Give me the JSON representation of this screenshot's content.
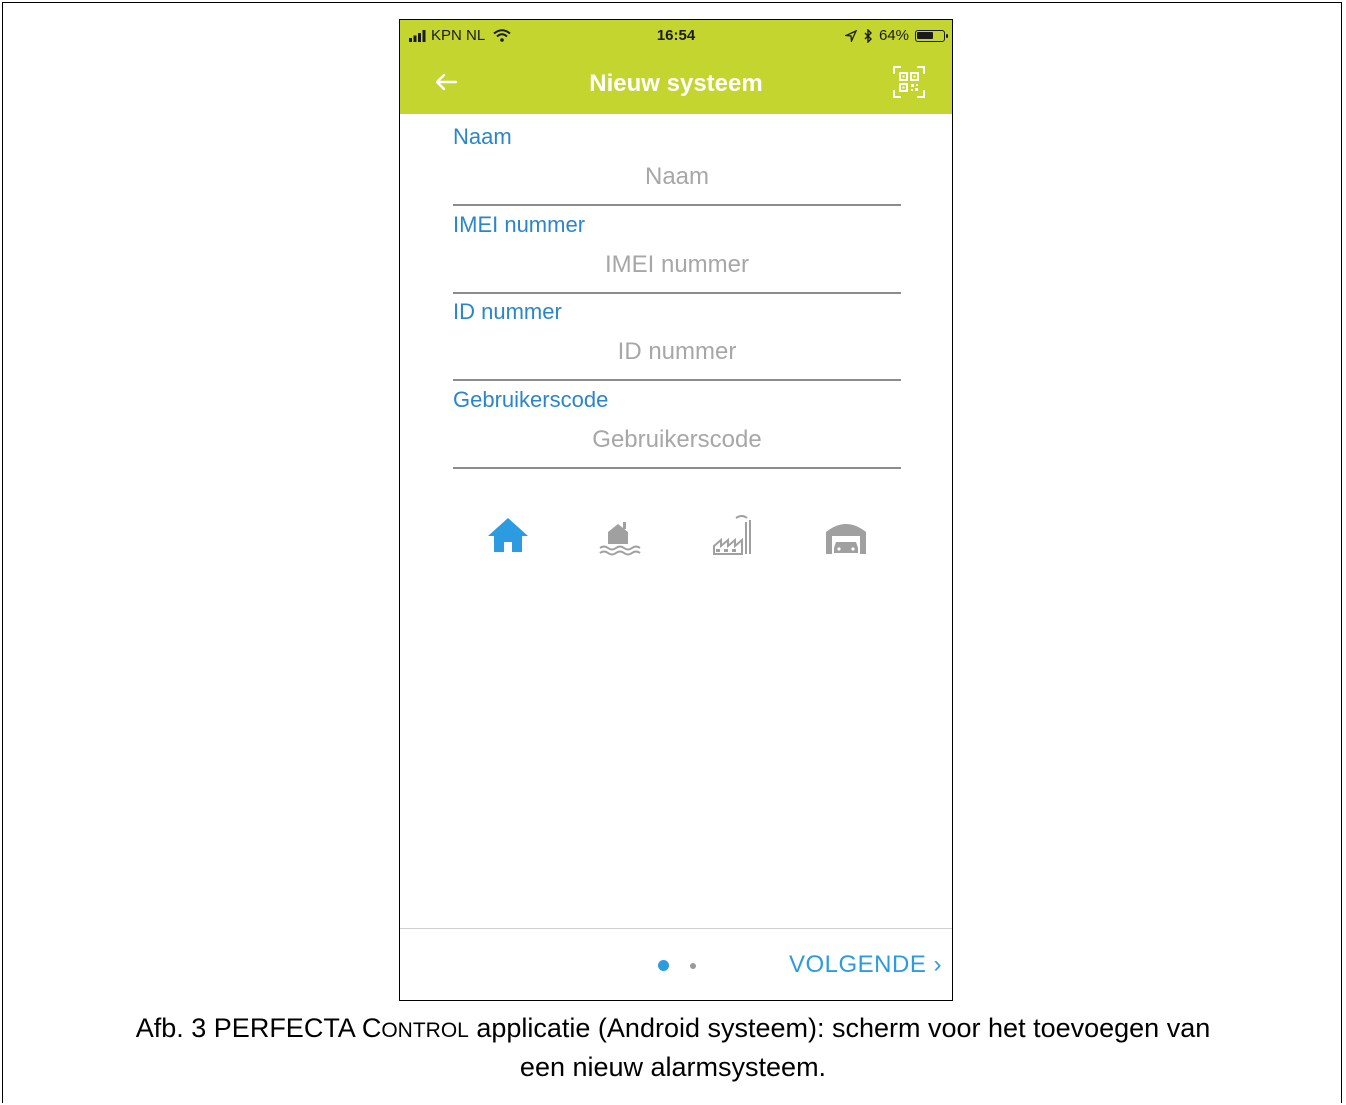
{
  "status_bar": {
    "carrier": "KPN NL",
    "time": "16:54",
    "battery_percent": "64%",
    "battery_level": 0.64
  },
  "app_bar": {
    "title": "Nieuw systeem",
    "back_icon": "arrow-left-icon",
    "qr_icon": "qr-scan-icon",
    "background_color": "#c5d530"
  },
  "form": {
    "fields": [
      {
        "label": "Naam",
        "placeholder": "Naam",
        "value": ""
      },
      {
        "label": "IMEI nummer",
        "placeholder": "IMEI nummer",
        "value": ""
      },
      {
        "label": "ID nummer",
        "placeholder": "ID nummer",
        "value": ""
      },
      {
        "label": "Gebruikerscode",
        "placeholder": "Gebruikerscode",
        "value": ""
      }
    ]
  },
  "system_types": {
    "selected": "home",
    "items": [
      {
        "key": "home",
        "icon": "house-icon",
        "active_color": "#2c9be0"
      },
      {
        "key": "holiday-house",
        "icon": "lake-house-icon"
      },
      {
        "key": "factory",
        "icon": "factory-icon"
      },
      {
        "key": "garage",
        "icon": "garage-icon"
      }
    ],
    "inactive_color": "#a0a0a0"
  },
  "footer": {
    "pages": 2,
    "current_page": 1,
    "next_label": "VOLGENDE ›"
  },
  "caption": {
    "prefix": "Afb. 3 PERFECTA C",
    "small_caps": "ONTROL",
    "suffix": " applicatie (Android systeem): scherm voor het toevoegen van",
    "line2": "een nieuw alarmsysteem."
  }
}
